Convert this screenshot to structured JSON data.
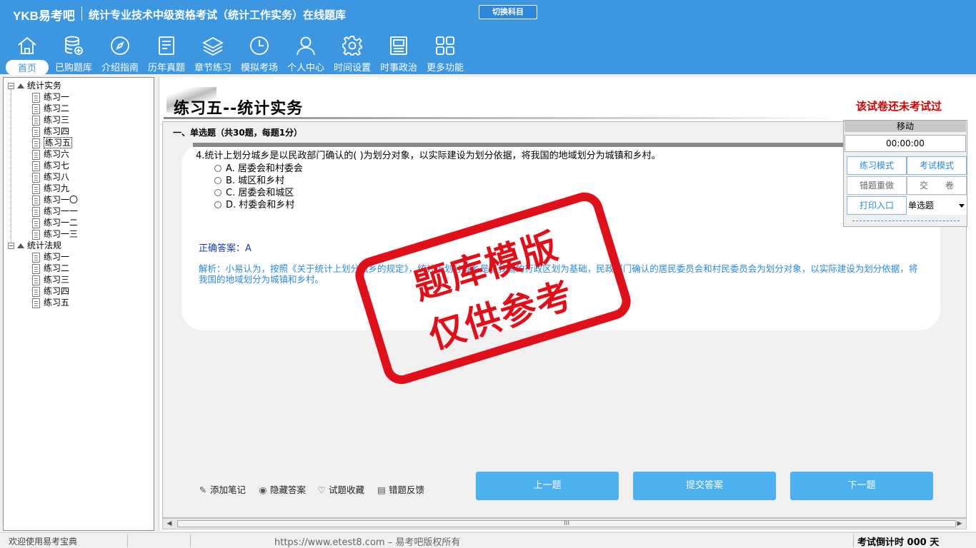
{
  "header": {
    "logo": "YKB易考吧",
    "app_title": "统计专业技术中级资格考试（统计工作实务）在线题库",
    "switch_label": "切换科目",
    "nav": [
      {
        "label": "首页",
        "icon": "home-icon"
      },
      {
        "label": "已购题库",
        "icon": "database-add-icon"
      },
      {
        "label": "介绍指南",
        "icon": "compass-icon"
      },
      {
        "label": "历年真题",
        "icon": "document-list-icon"
      },
      {
        "label": "章节练习",
        "icon": "layers-icon"
      },
      {
        "label": "模拟考场",
        "icon": "clock-icon"
      },
      {
        "label": "个人中心",
        "icon": "user-icon"
      },
      {
        "label": "时间设置",
        "icon": "gear-icon"
      },
      {
        "label": "时事政治",
        "icon": "newspaper-icon"
      },
      {
        "label": "更多功能",
        "icon": "grid-icon"
      }
    ]
  },
  "tree": {
    "groups": [
      {
        "label": "统计实务",
        "items": [
          "练习一",
          "练习二",
          "练习三",
          "练习四",
          "练习五",
          "练习六",
          "练习七",
          "练习八",
          "练习九",
          "练习一〇",
          "练习一一",
          "练习一二",
          "练习一三"
        ]
      },
      {
        "label": "统计法规",
        "items": [
          "练习一",
          "练习二",
          "练习三",
          "练习四",
          "练习五"
        ]
      }
    ],
    "selected": "练习五"
  },
  "main": {
    "page_title": "练习五--统计实务",
    "not_taken": "该试卷还未考试过",
    "section": "一、单选题（共30题，每题1分）",
    "question": "4.统计上划分城乡是以民政部门确认的( )为划分对象，以实际建设为划分依据，将我国的地域划分为城镇和乡村。",
    "options": [
      "A. 居委会和村委会",
      "B. 城区和乡村",
      "C. 居委会和城区",
      "D. 村委会和乡村"
    ],
    "answer_label": "正确答案：A",
    "analysis": "解析：小易认为，按照《关于统计上划分城乡的规定》，统计上划分城乡是以我国的行政区划为基础，民政部门确认的居民委员会和村民委员会为划分对象，以实际建设为划分依据，将我国的地域划分为城镇和乡村。",
    "tools": [
      "添加笔记",
      "隐藏答案",
      "试题收藏",
      "错题反馈"
    ],
    "buttons": {
      "prev": "上一题",
      "submit": "提交答案",
      "next": "下一题"
    },
    "scroll_mark": "III"
  },
  "mode_panel": {
    "move": "移动",
    "timer": "00:00:00",
    "practice_mode": "练习模式",
    "exam_mode": "考试模式",
    "redo_wrong": "错题重做",
    "hand_in": "交　　卷",
    "print": "打印入口",
    "qtype": "单选题"
  },
  "status": {
    "welcome": "欢迎使用易考宝典",
    "site": "https://www.etest8.com – 易考吧版权所有",
    "countdown": "考试倒计时 000 天"
  },
  "watermark": {
    "line1": "题库模版",
    "line2": "仅供参考"
  },
  "colors": {
    "header": "#3c96e0",
    "accent_button": "#4db1f0",
    "stamp": "#e0101a",
    "warning": "#cc0000"
  }
}
